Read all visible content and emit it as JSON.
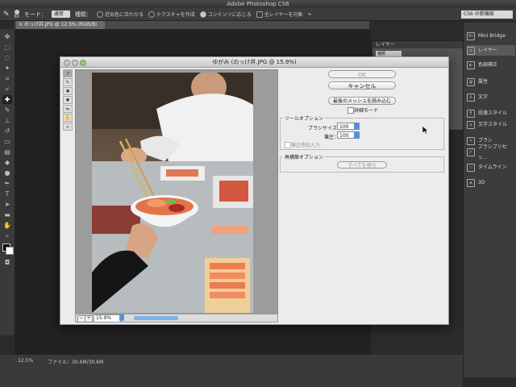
{
  "app": {
    "title": "Adobe Photoshop CS6"
  },
  "options_bar": {
    "mode_label": "モード：",
    "mode_value": "通常",
    "type_label": "種類：",
    "opt1": "近似色に合わせる",
    "opt2": "テクスチャを作成",
    "opt3": "コンテンツに応じる",
    "all_layers": "全レイヤーを対象",
    "brush_size": "60",
    "workspace": "CS6 の新機能"
  },
  "document": {
    "tab_label": "のっけ丼.JPG @ 12.5% (RGB/8)"
  },
  "layers_panel": {
    "title": "レイヤー",
    "kind": "種類"
  },
  "right_panels": [
    "Mini Bridge",
    "レイヤー",
    "色調補正",
    "属性",
    "文字",
    "段落スタイル",
    "文字スタイル",
    "ブラシ",
    "ブラシプリセッ...",
    "タイムライン",
    "3D"
  ],
  "dialog": {
    "title": "ゆがみ (のっけ丼.JPG @ 15.9%)",
    "ok": "OK",
    "cancel": "キャンセル",
    "load_last_mesh": "最後のメッシュを読み込む",
    "advanced_mode": "詳細モード",
    "tool_options": "ツールオプション",
    "brush_size_label": "ブラシサイズ：",
    "brush_size_value": "100",
    "pressure_label": "筆圧：",
    "pressure_value": "100",
    "stylus_label": "筆圧感知入力",
    "reconstruct_options": "再構築オプション",
    "restore_all": "すべてを復元",
    "zoom": "15.9%",
    "zoom_progress": 0.22
  },
  "status": {
    "zoom": "12.5%",
    "file": "ファイル：30.6M/30.6M"
  },
  "colors": {
    "accent": "#5a8fd8",
    "panel": "#3c3c3c",
    "dialog": "#ececec"
  }
}
